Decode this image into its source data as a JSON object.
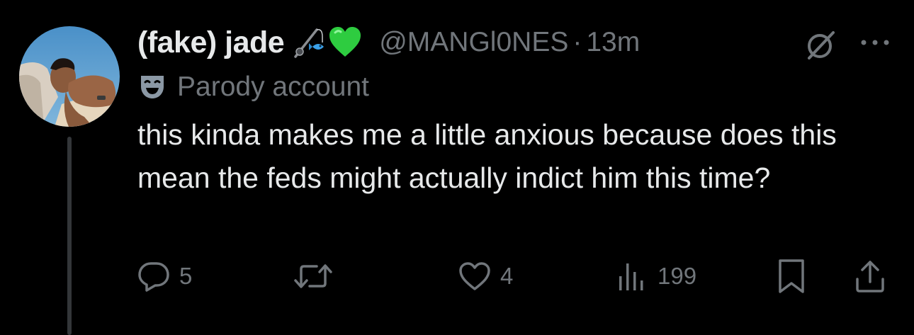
{
  "tweet": {
    "display_name": "(fake) jade",
    "emojis": [
      "fishing-pole-emoji",
      "green-heart-emoji"
    ],
    "handle": "@MANGl0NES",
    "separator": "·",
    "time": "13m",
    "parody_label": "Parody account",
    "text": "this kinda makes me a little anxious because does this mean the feds might actually indict him this time?"
  },
  "actions": {
    "replies": "5",
    "reposts": "",
    "likes": "4",
    "views": "199"
  },
  "icons": {
    "avatar": "profile-photo",
    "grok": "grok-slash-icon",
    "more": "more-dots-icon",
    "parody": "theater-mask-icon",
    "reply": "reply-bubble-icon",
    "repost": "repost-arrows-icon",
    "like": "heart-icon",
    "views": "bar-chart-icon",
    "bookmark": "bookmark-icon",
    "share": "share-upload-icon"
  },
  "colors": {
    "background": "#000000",
    "primary_text": "#e7e9ea",
    "secondary_text": "#71767b",
    "thread_line": "#333639",
    "green_heart": "#2ecc40"
  }
}
